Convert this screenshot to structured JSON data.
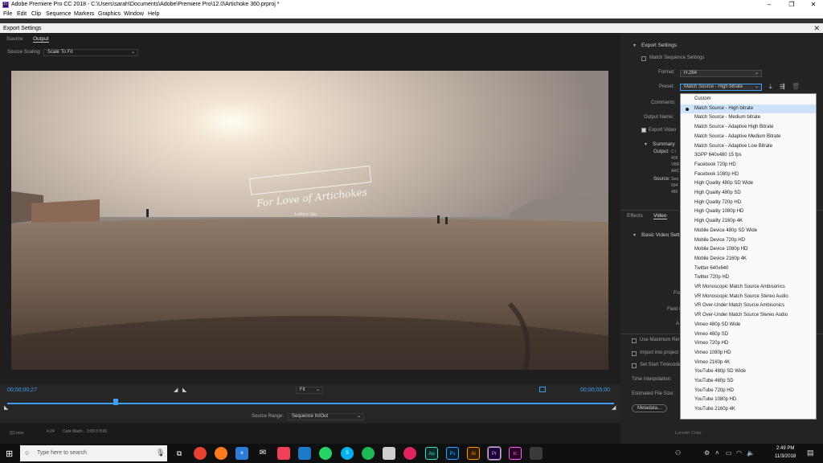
{
  "window": {
    "title": "Adobe Premiere Pro CC 2018 - C:\\Users\\sarah\\Documents\\Adobe\\Premiere Pro\\12.0\\Artichoke 360.prproj *",
    "app_icon": "Pr",
    "minimize": "–",
    "maximize": "❐",
    "close": "✕"
  },
  "menu": [
    "File",
    "Edit",
    "Clip",
    "Sequence",
    "Markers",
    "Graphics",
    "Window",
    "Help"
  ],
  "dialog": {
    "title": "Export Settings",
    "close": "✕",
    "tabs": [
      "Source",
      "Output"
    ],
    "source_scaling_label": "Source Scaling:",
    "source_scaling_value": "Scale To Fit",
    "watermark_title": "For Love of Artichokes",
    "watermark_sub": "Lettuce Tale",
    "timecode_start": "00;00;00;27",
    "timecode_end": "00;00;05;00",
    "fit_value": "Fit",
    "source_range_label": "Source Range:",
    "source_range_value": "Sequence In/Out"
  },
  "bottom_strip": [
    "Q1.mov",
    "4:24",
    "Cafe Madri...",
    "3:09:37526"
  ],
  "right": {
    "export_settings_heading": "Export Settings",
    "match_sequence_label": "Match Sequence Settings",
    "format_label": "Format:",
    "format_value": "H.264",
    "preset_label": "Preset:",
    "preset_value": "Match Source - High bitrate",
    "comments_label": "Comments:",
    "output_name_label": "Output Name:",
    "export_video_label": "Export Video",
    "summary_heading": "Summary",
    "summary_output_label": "Output:",
    "summary_output_lines": [
      "C:\\",
      "409",
      "VBR",
      "AAC"
    ],
    "summary_source_label": "Source:",
    "summary_source_lines": [
      "Seq",
      "694",
      "480"
    ],
    "tabs": [
      "Effects",
      "Video"
    ],
    "basic_video_heading": "Basic Video Settin",
    "side_labels": [
      "Frame",
      "Field O",
      "A"
    ],
    "use_max_render": "Use Maximum Ren",
    "import_into_project": "Import into project",
    "set_start_timecode": "Set Start Timecode",
    "time_interpolation": "Time Interpolation:",
    "estimated_file_size": "Estimated File Size:",
    "metadata_button": "Metadata...",
    "lumetri": "Lumetri Color"
  },
  "dropdown": {
    "selected_index": 1,
    "highlighted_index": 34,
    "options": [
      "Custom",
      "Match Source - High bitrate",
      "Match Source - Medium bitrate",
      "Match Source - Adaptive High Bitrate",
      "Match Source - Adaptive Medium Bitrate",
      "Match Source - Adaptive Low Bitrate",
      "3GPP 640x480 15 fps",
      "Facebook 720p HD",
      "Facebook 1080p HD",
      "High Quality 480p SD Wide",
      "High Quality 480p SD",
      "High Quality 720p HD",
      "High Quality 1080p HD",
      "High Quality 2160p 4K",
      "Mobile Device 480p SD Wide",
      "Mobile Device 720p HD",
      "Mobile Device 1080p HD",
      "Mobile Device 2160p 4K",
      "Twitter 640x640",
      "Twitter 720p HD",
      "VR Monoscopic Match Source Ambisonics",
      "VR Monoscopic Match Source Stereo Audio",
      "VR Over-Under Match Source Ambisonics",
      "VR Over-Under Match Source Stereo Audio",
      "Vimeo 480p SD Wide",
      "Vimeo 480p SD",
      "Vimeo 720p HD",
      "Vimeo 1080p HD",
      "Vimeo 2160p 4K",
      "YouTube 480p SD Wide",
      "YouTube 480p SD",
      "YouTube 720p HD",
      "YouTube 1080p HD",
      "YouTube 2160p 4K"
    ]
  },
  "taskbar": {
    "search_placeholder": "Type here to search",
    "time": "2:49 PM",
    "date": "11/3/2018",
    "apps": [
      "Au",
      "Ps",
      "Ai",
      "Pr",
      "Ic"
    ]
  },
  "colors": {
    "accent_blue": "#3ea0f5",
    "selection_highlight": "#bcd6f2"
  }
}
